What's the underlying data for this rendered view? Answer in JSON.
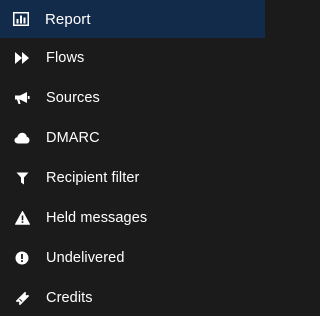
{
  "sidebar": {
    "items": [
      {
        "label": "Report",
        "icon": "bar-chart-icon",
        "active": true
      },
      {
        "label": "Flows",
        "icon": "fast-forward-icon",
        "active": false
      },
      {
        "label": "Sources",
        "icon": "megaphone-icon",
        "active": false
      },
      {
        "label": "DMARC",
        "icon": "cloud-icon",
        "active": false
      },
      {
        "label": "Recipient filter",
        "icon": "filter-icon",
        "active": false
      },
      {
        "label": "Held messages",
        "icon": "warning-icon",
        "active": false
      },
      {
        "label": "Undelivered",
        "icon": "exclamation-circle-icon",
        "active": false
      },
      {
        "label": "Credits",
        "icon": "ticket-icon",
        "active": false
      }
    ]
  },
  "colors": {
    "background": "#1b1b1b",
    "active_background": "#132b4a",
    "text": "#ffffff"
  }
}
